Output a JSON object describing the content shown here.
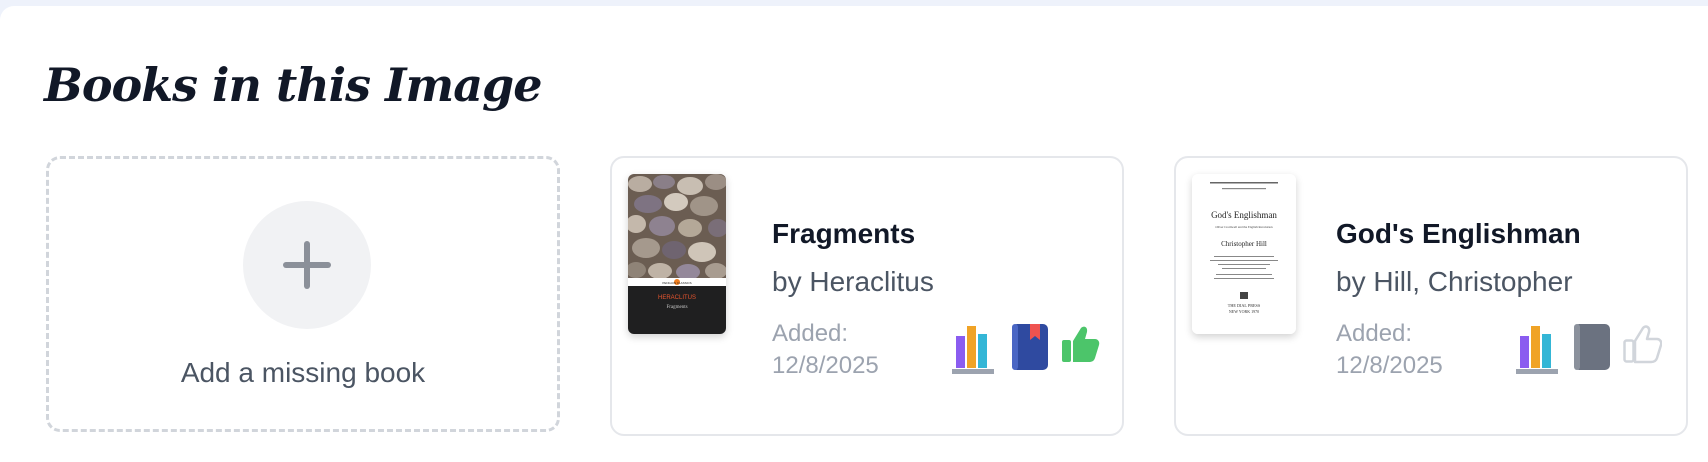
{
  "section": {
    "title": "Books in this Image"
  },
  "add_card": {
    "label": "Add a missing book",
    "icon": "plus-icon"
  },
  "books": [
    {
      "title": "Fragments",
      "author": "by Heraclitus",
      "added_label": "Added:",
      "added_date": "12/8/2025",
      "cover": {
        "series_band": "PENGUIN CLASSICS",
        "title_text": "HERACLITUS",
        "subtitle_text": "Fragments"
      },
      "status_icons": [
        "shelf-icon",
        "bookmark-icon",
        "thumbs-up-icon"
      ],
      "colors": {
        "shelf_state": "active",
        "bookmark": "#2f4aa0",
        "thumbs_up": "#4cc56a"
      }
    },
    {
      "title": "God's Englishman",
      "author": "by Hill, Christopher",
      "added_label": "Added:",
      "added_date": "12/8/2025",
      "cover": {
        "title_text": "God's Englishman",
        "subtitle_text": "Oliver Cromwell and the English Revolution",
        "author_text": "Christopher Hill",
        "publisher_text": "THE DIAL PRESS",
        "place_text": "NEW YORK 1970"
      },
      "status_icons": [
        "shelf-icon",
        "bookmark-icon",
        "thumbs-up-icon"
      ],
      "colors": {
        "shelf_state": "active",
        "bookmark": "#6b7280",
        "thumbs_up": "#d1d5db"
      }
    }
  ]
}
